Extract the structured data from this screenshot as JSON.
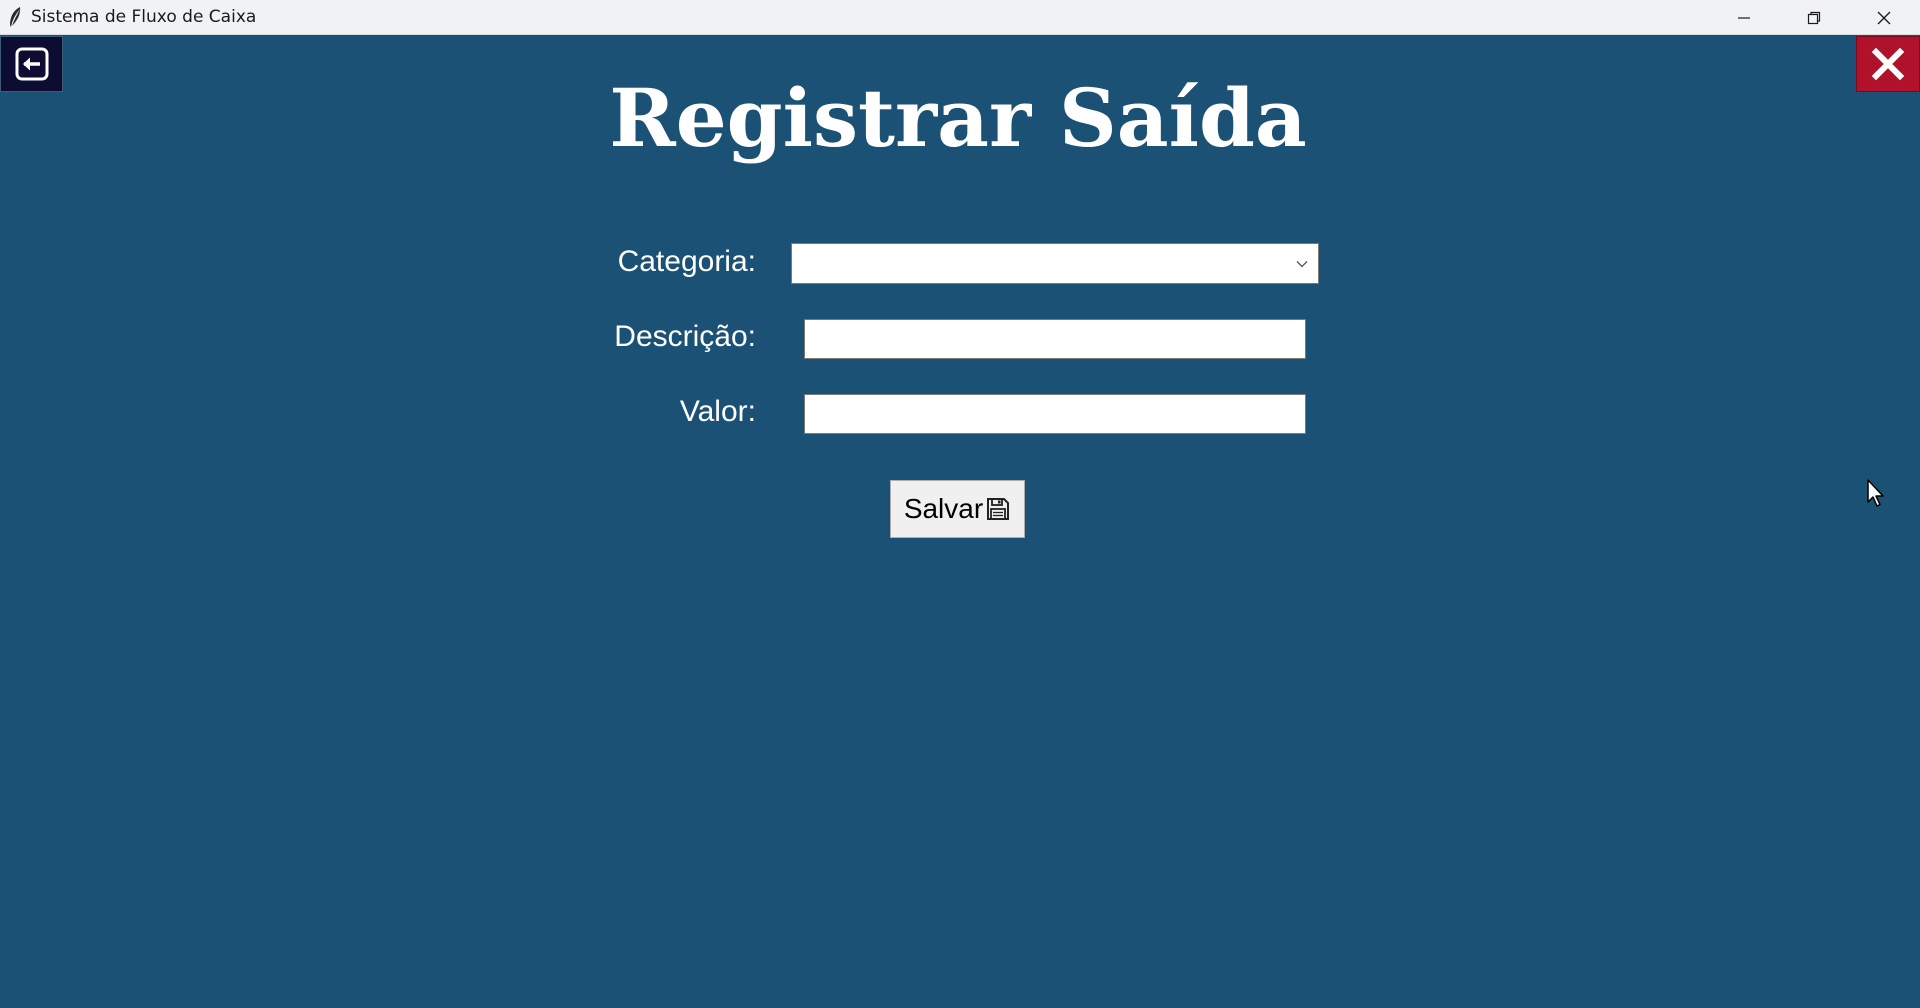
{
  "window": {
    "title": "Sistema de Fluxo de Caixa",
    "app_icon": "feather-icon",
    "controls": [
      "minimize-icon",
      "restore-icon",
      "close-icon"
    ]
  },
  "toolbar": {
    "back_icon": "back-arrow-icon",
    "exit_icon": "close-x-icon"
  },
  "page": {
    "title": "Registrar Saída"
  },
  "form": {
    "categoria": {
      "label": "Categoria:",
      "value": "",
      "icon": "chevron-down-icon"
    },
    "descricao": {
      "label": "Descrição:",
      "value": ""
    },
    "valor": {
      "label": "Valor:",
      "value": ""
    },
    "save_button": {
      "label": "Salvar",
      "icon": "floppy-disk-icon"
    }
  },
  "colors": {
    "background": "#1b5174",
    "back_button": "#0d0d33",
    "exit_button": "#b0112b",
    "title_bar": "#f0f2f6"
  }
}
